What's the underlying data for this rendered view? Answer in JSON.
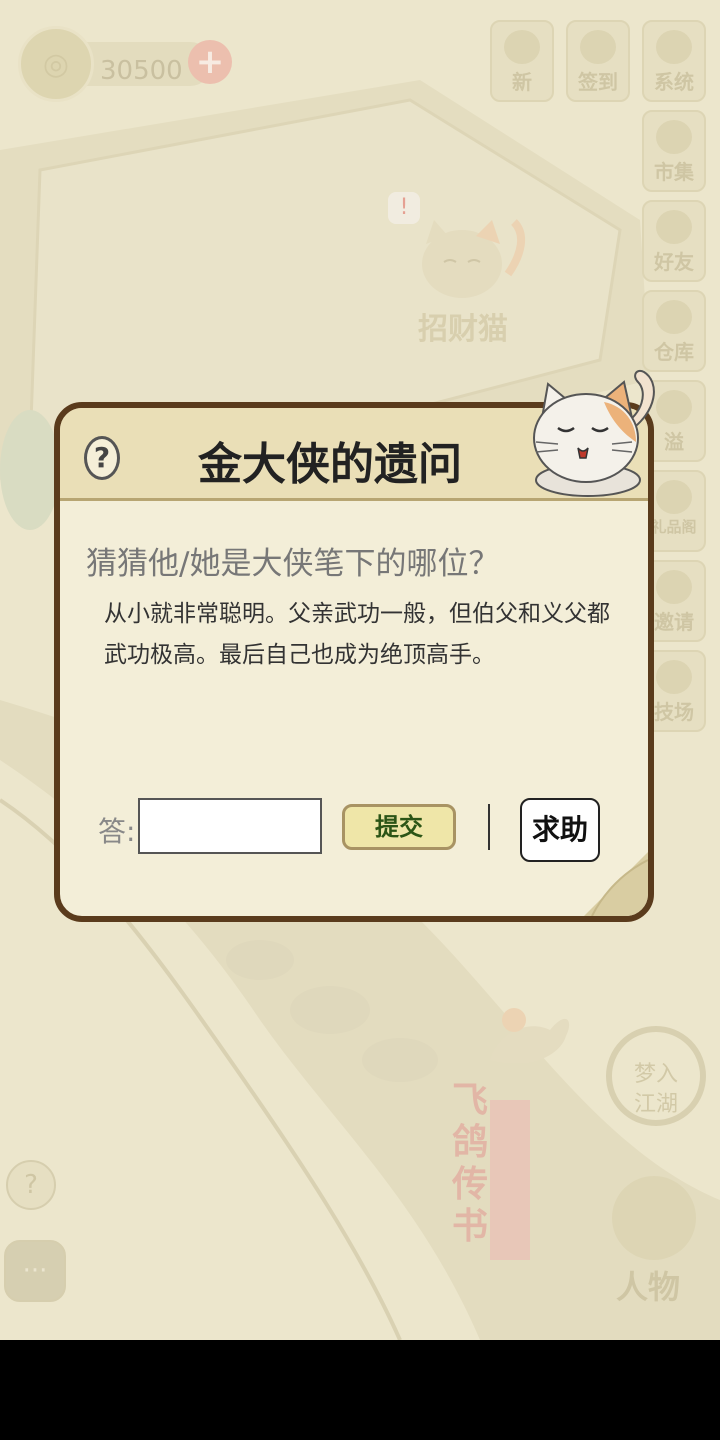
{
  "hud": {
    "coins": "30500",
    "plus_symbol": "+",
    "top_buttons": [
      {
        "label": "新",
        "icon": "moon-bell-icon"
      },
      {
        "label": "签到",
        "icon": "moon-cat-icon"
      },
      {
        "label": "系统",
        "icon": "menu-icon"
      }
    ],
    "side_buttons": [
      {
        "label": "市集",
        "icon": "flag-icon"
      },
      {
        "label": "好友",
        "icon": "friends-icon"
      },
      {
        "label": "仓库",
        "icon": "box-icon"
      },
      {
        "label": "溢",
        "icon": "gear-icon"
      },
      {
        "label": "礼品阁",
        "icon": "gift-icon"
      },
      {
        "label": "邀请",
        "icon": "invite-icon"
      },
      {
        "label": "技场",
        "icon": "swords-icon"
      }
    ]
  },
  "scene": {
    "lucky_cat_label": "招财猫",
    "alert_symbol": "!",
    "pigeon_label_1": "飞鸽",
    "pigeon_label_2": "传书",
    "dream_1": "梦入",
    "dream_2": "江湖",
    "person_label": "人物",
    "help_symbol": "?"
  },
  "dialog": {
    "title": "金大侠的遗问",
    "help_symbol": "?",
    "question": "猜猜他/她是大侠笔下的哪位？",
    "clue": "从小就非常聪明。父亲武功一般，但伯父和义父都武功极高。最后自己也成为绝顶高手。",
    "answer_label": "答:",
    "answer_value": "",
    "answer_placeholder": "",
    "submit_label": "提交",
    "seek_help_label": "求助"
  },
  "colors": {
    "dialog_border": "#5a3b1c",
    "dialog_bg": "#f3eed8",
    "submit_text": "#2c5516"
  }
}
